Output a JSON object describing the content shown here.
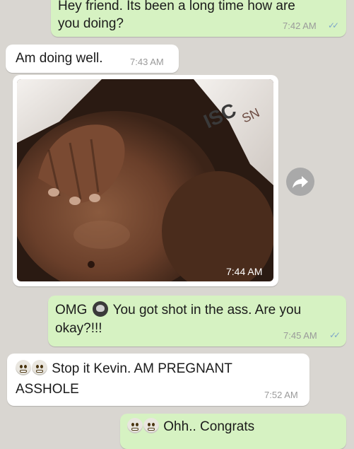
{
  "messages": [
    {
      "id": "m1",
      "direction": "outgoing",
      "text_lines": [
        "Hey friend. Its been a long time how are",
        "you doing?"
      ],
      "time": "7:42 AM",
      "ticks": "✓✓"
    },
    {
      "id": "m2",
      "direction": "incoming",
      "text": "Am doing well.",
      "time": "7:43 AM"
    },
    {
      "id": "m3",
      "direction": "incoming",
      "type": "image",
      "time": "7:44 AM",
      "icon": "forward-icon"
    },
    {
      "id": "m4",
      "direction": "outgoing",
      "text_a": "OMG",
      "text_b": "You got shot in the ass. Are you",
      "text_c": "okay?!!!",
      "time": "7:45 AM",
      "ticks": "✓✓",
      "emoji": "skull-emoji"
    },
    {
      "id": "m5",
      "direction": "incoming",
      "text_a": "Stop it Kevin. AM PREGNANT",
      "text_b": "ASSHOLE",
      "time": "7:52 AM",
      "emoji": "grimacing-emoji"
    },
    {
      "id": "m6",
      "direction": "outgoing",
      "text": "Ohh.. Congrats",
      "emoji": "grimacing-emoji"
    }
  ],
  "colors": {
    "outgoing": "#d6f2c2",
    "incoming": "#ffffff",
    "background": "#d9d6d1",
    "tick": "#7fa6c9"
  }
}
